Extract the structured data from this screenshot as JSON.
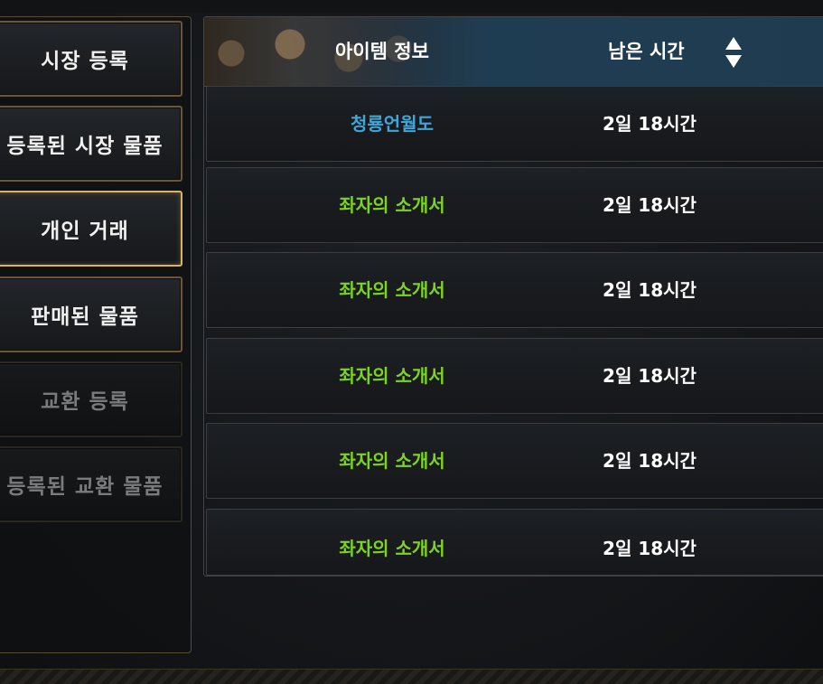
{
  "menu": {
    "items": [
      {
        "label": "시장 등록",
        "state": "normal"
      },
      {
        "label": "등록된 시장 물품",
        "state": "normal"
      },
      {
        "label": "개인 거래",
        "state": "active"
      },
      {
        "label": "판매된 물품",
        "state": "normal"
      },
      {
        "label": "교환 등록",
        "state": "disabled"
      },
      {
        "label": "등록된 교환 물품",
        "state": "disabled"
      }
    ]
  },
  "table": {
    "header": {
      "item_info": "아이템 정보",
      "time_left": "남은 시간"
    },
    "rows": [
      {
        "name": "청룡언월도",
        "time": "2일 18시간",
        "color": "#3ea6d8"
      },
      {
        "name": "좌자의 소개서",
        "time": "2일 18시간",
        "color": "#7ed321"
      },
      {
        "name": "좌자의 소개서",
        "time": "2일 18시간",
        "color": "#7ed321"
      },
      {
        "name": "좌자의 소개서",
        "time": "2일 18시간",
        "color": "#7ed321"
      },
      {
        "name": "좌자의 소개서",
        "time": "2일 18시간",
        "color": "#7ed321"
      },
      {
        "name": "좌자의 소개서",
        "time": "2일 18시간",
        "color": "#7ed321"
      }
    ]
  },
  "icons": {
    "sort": "sort-updown-icon"
  },
  "colors": {
    "active_border": "#d9b45d",
    "rare_item": "#3ea6d8",
    "common_item": "#7ed321"
  }
}
